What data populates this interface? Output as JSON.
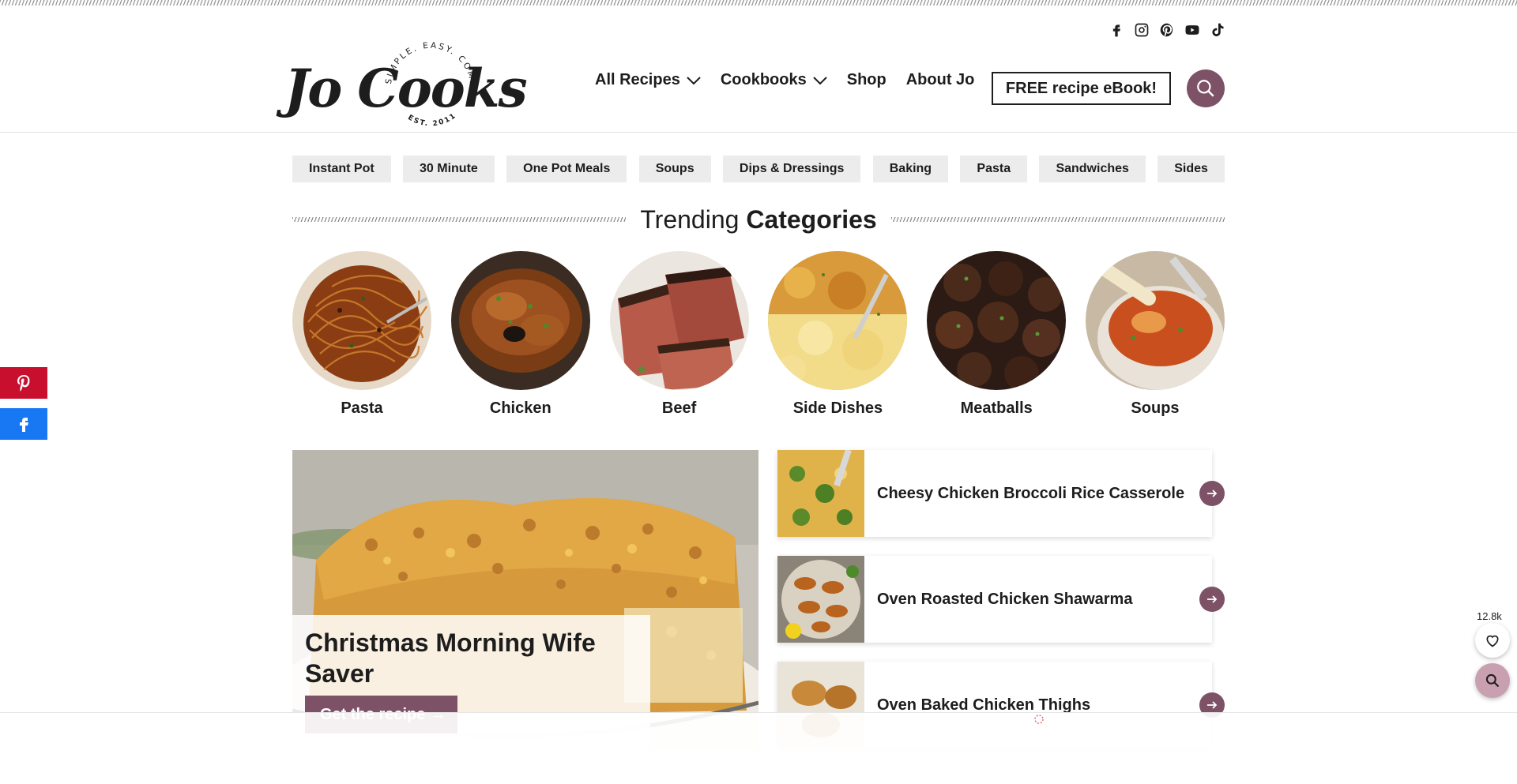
{
  "header": {
    "logo_text": "Jo Cooks",
    "logo_tagline": "SIMPLE. EASY. COMFORT.",
    "logo_est": "EST. 2011",
    "social": [
      "facebook-icon",
      "instagram-icon",
      "pinterest-icon",
      "youtube-icon",
      "tiktok-icon"
    ],
    "nav": [
      {
        "label": "All Recipes",
        "dropdown": true
      },
      {
        "label": "Cookbooks",
        "dropdown": true
      },
      {
        "label": "Shop",
        "dropdown": false
      },
      {
        "label": "About Jo",
        "dropdown": false
      }
    ],
    "ebook_label": "FREE recipe eBook!"
  },
  "chips": [
    "Instant Pot",
    "30 Minute",
    "One Pot Meals",
    "Soups",
    "Dips & Dressings",
    "Baking",
    "Pasta",
    "Sandwiches",
    "Sides"
  ],
  "trending": {
    "title_light": "Trending",
    "title_bold": "Categories",
    "categories": [
      "Pasta",
      "Chicken",
      "Beef",
      "Side Dishes",
      "Meatballs",
      "Soups"
    ]
  },
  "featured": {
    "title": "Christmas Morning Wife Saver",
    "cta": "Get the recipe",
    "cta_arrow": "→"
  },
  "recipes": [
    "Cheesy Chicken Broccoli Rice Casserole",
    "Oven Roasted Chicken Shawarma",
    "Oven Baked Chicken Thighs"
  ],
  "floating": {
    "like_count": "12.8k"
  },
  "colors": {
    "accent": "#7e5266",
    "pinterest": "#c8102e",
    "facebook": "#1877f2",
    "chip_bg": "#ececec"
  }
}
